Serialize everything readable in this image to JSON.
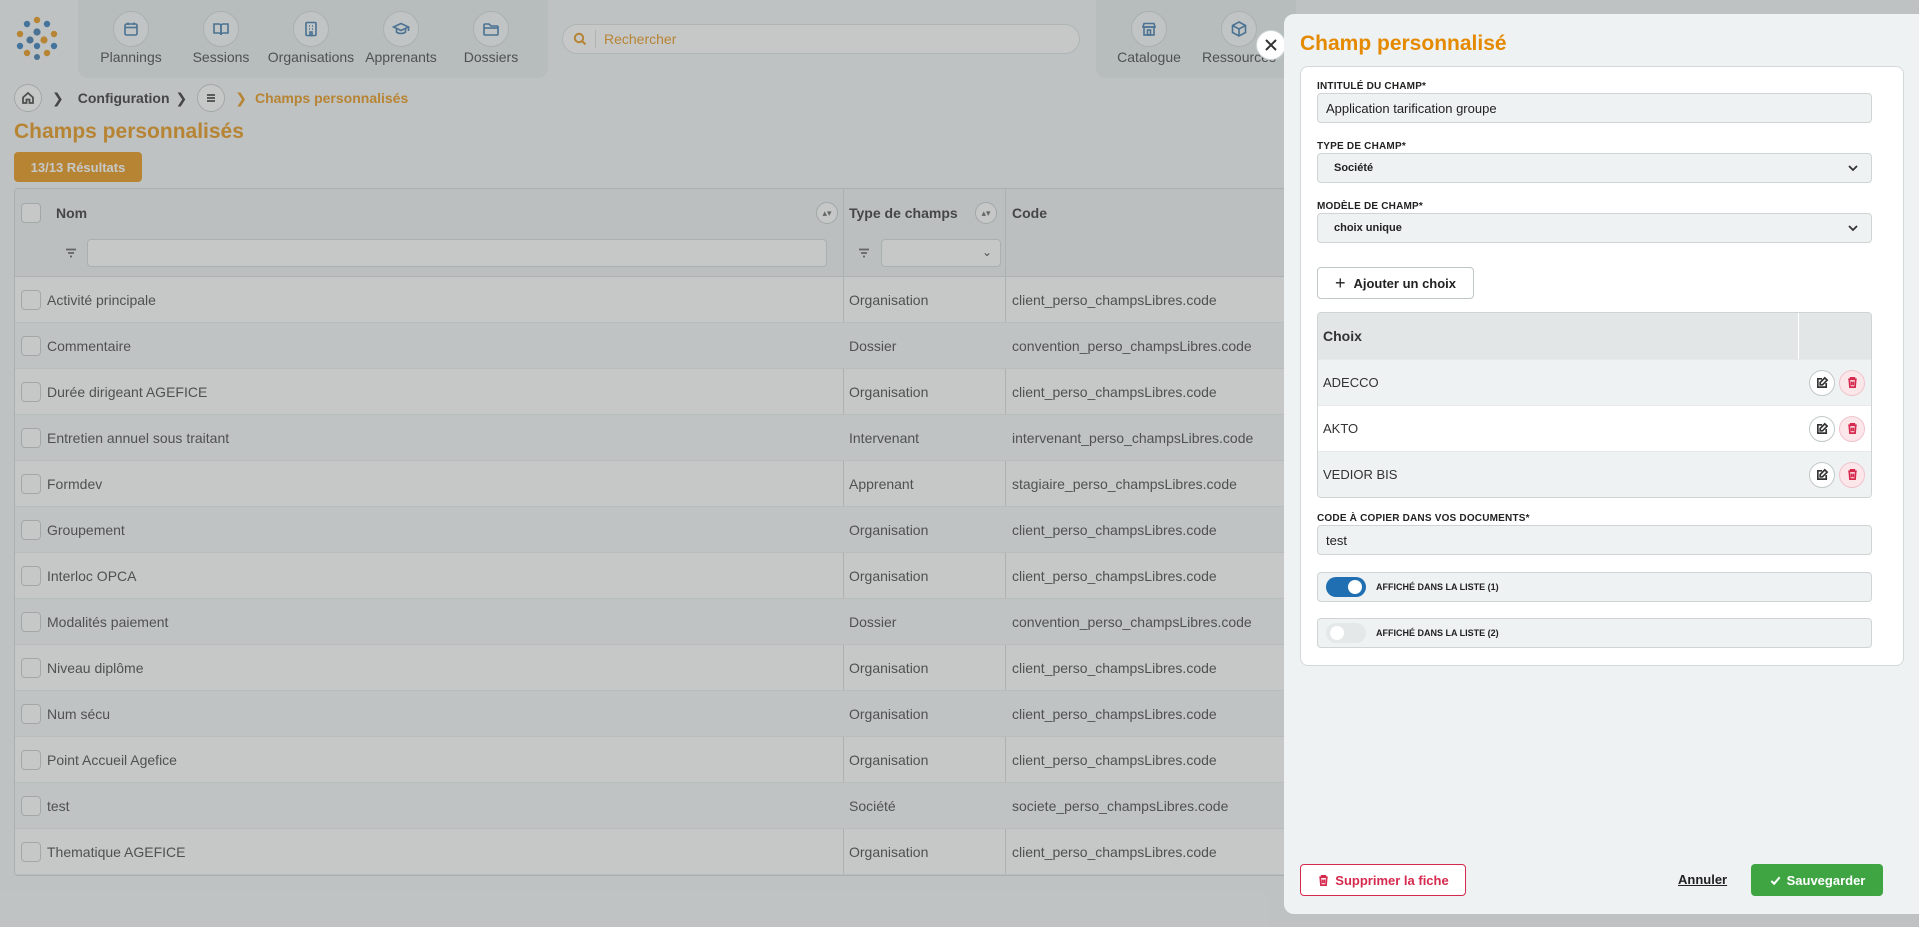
{
  "topbar": {
    "nav_left": [
      {
        "label": "Plannings",
        "icon": "calendar-icon"
      },
      {
        "label": "Sessions",
        "icon": "book-icon"
      },
      {
        "label": "Organisations",
        "icon": "building-icon"
      },
      {
        "label": "Apprenants",
        "icon": "graduation-cap-icon"
      },
      {
        "label": "Dossiers",
        "icon": "folder-icon"
      }
    ],
    "search_placeholder": "Rechercher",
    "nav_right": [
      {
        "label": "Catalogue",
        "icon": "store-icon"
      },
      {
        "label": "Ressources",
        "icon": "box-icon"
      }
    ]
  },
  "breadcrumb": {
    "section": "Configuration",
    "current": "Champs personnalisés"
  },
  "page": {
    "title": "Champs personnalisés",
    "results": "13/13 Résultats"
  },
  "table": {
    "columns": [
      "Nom",
      "Type de champs",
      "Code"
    ],
    "rows": [
      {
        "nom": "Activité principale",
        "type": "Organisation",
        "code": "client_perso_champsLibres.code"
      },
      {
        "nom": "Commentaire",
        "type": "Dossier",
        "code": "convention_perso_champsLibres.code"
      },
      {
        "nom": "Durée dirigeant AGEFICE",
        "type": "Organisation",
        "code": "client_perso_champsLibres.code"
      },
      {
        "nom": "Entretien annuel sous traitant",
        "type": "Intervenant",
        "code": "intervenant_perso_champsLibres.code"
      },
      {
        "nom": "Formdev",
        "type": "Apprenant",
        "code": "stagiaire_perso_champsLibres.code"
      },
      {
        "nom": "Groupement",
        "type": "Organisation",
        "code": "client_perso_champsLibres.code"
      },
      {
        "nom": "Interloc OPCA",
        "type": "Organisation",
        "code": "client_perso_champsLibres.code"
      },
      {
        "nom": "Modalités paiement",
        "type": "Dossier",
        "code": "convention_perso_champsLibres.code"
      },
      {
        "nom": "Niveau diplôme",
        "type": "Organisation",
        "code": "client_perso_champsLibres.code"
      },
      {
        "nom": "Num sécu",
        "type": "Organisation",
        "code": "client_perso_champsLibres.code"
      },
      {
        "nom": "Point Accueil Agefice",
        "type": "Organisation",
        "code": "client_perso_champsLibres.code"
      },
      {
        "nom": "test",
        "type": "Société",
        "code": "societe_perso_champsLibres.code"
      },
      {
        "nom": "Thematique AGEFICE",
        "type": "Organisation",
        "code": "client_perso_champsLibres.code"
      }
    ]
  },
  "panel": {
    "title": "Champ personnalisé",
    "intitule_label": "INTITULÉ DU CHAMP*",
    "intitule_value": "Application tarification groupe",
    "type_label": "TYPE DE CHAMP*",
    "type_value": "Société",
    "modele_label": "MODÈLE DE CHAMP*",
    "modele_value": "choix unique",
    "add_choice_label": "Ajouter un choix",
    "choices_header": "Choix",
    "choices": [
      "ADECCO",
      "AKTO",
      "VEDIOR BIS"
    ],
    "code_label": "CODE À COPIER DANS VOS DOCUMENTS*",
    "code_value": "test",
    "toggle1_label": "AFFICHÉ DANS LA LISTE (1)",
    "toggle1_on": true,
    "toggle2_label": "AFFICHÉ DANS LA LISTE (2)",
    "toggle2_on": false,
    "delete_label": "Supprimer la fiche",
    "cancel_label": "Annuler",
    "save_label": "Sauvegarder"
  },
  "colors": {
    "accent": "#e58a00",
    "primary_blue": "#1f6fb2",
    "danger": "#d6294e",
    "success": "#3fa543"
  }
}
